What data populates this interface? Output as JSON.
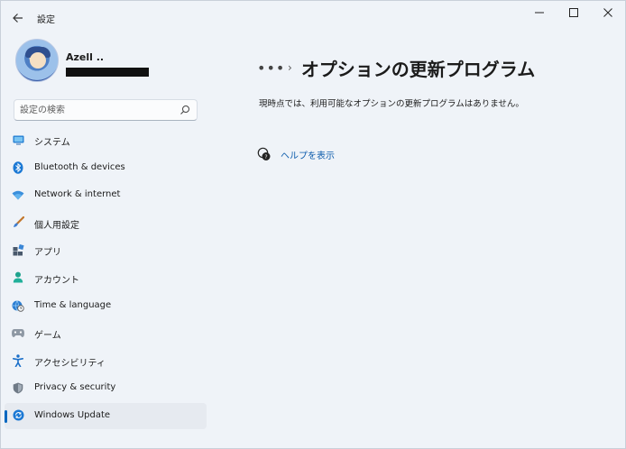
{
  "window": {
    "title": "設定",
    "controls": {
      "minimize": "–",
      "maximize": "☐",
      "close": "✕"
    }
  },
  "profile": {
    "name": "Azell .."
  },
  "search": {
    "placeholder": "設定の検索"
  },
  "sidebar": {
    "items": [
      {
        "label": "システム",
        "icon": "system-monitor-icon"
      },
      {
        "label": "Bluetooth & devices",
        "icon": "bluetooth-icon"
      },
      {
        "label": "Network & internet",
        "icon": "wifi-icon"
      },
      {
        "label": "個人用設定",
        "icon": "brush-icon"
      },
      {
        "label": "アプリ",
        "icon": "apps-icon"
      },
      {
        "label": "アカウント",
        "icon": "account-icon"
      },
      {
        "label": "Time & language",
        "icon": "globe-clock-icon"
      },
      {
        "label": "ゲーム",
        "icon": "gamepad-icon"
      },
      {
        "label": "アクセシビリティ",
        "icon": "accessibility-icon"
      },
      {
        "label": "Privacy & security",
        "icon": "shield-icon"
      },
      {
        "label": "Windows Update",
        "icon": "windows-update-icon",
        "selected": true
      }
    ]
  },
  "main": {
    "breadcrumb_more": "•••",
    "breadcrumb_chevron": "›",
    "title": "オプションの更新プログラム",
    "message": "現時点では、利用可能なオプションの更新プログラムはありません。",
    "help_link": "ヘルプを表示"
  },
  "colors": {
    "accent": "#0067c0",
    "window_bg": "#eff3f8",
    "selected_bg": "#e6eaf0",
    "link": "#0d5cac"
  }
}
